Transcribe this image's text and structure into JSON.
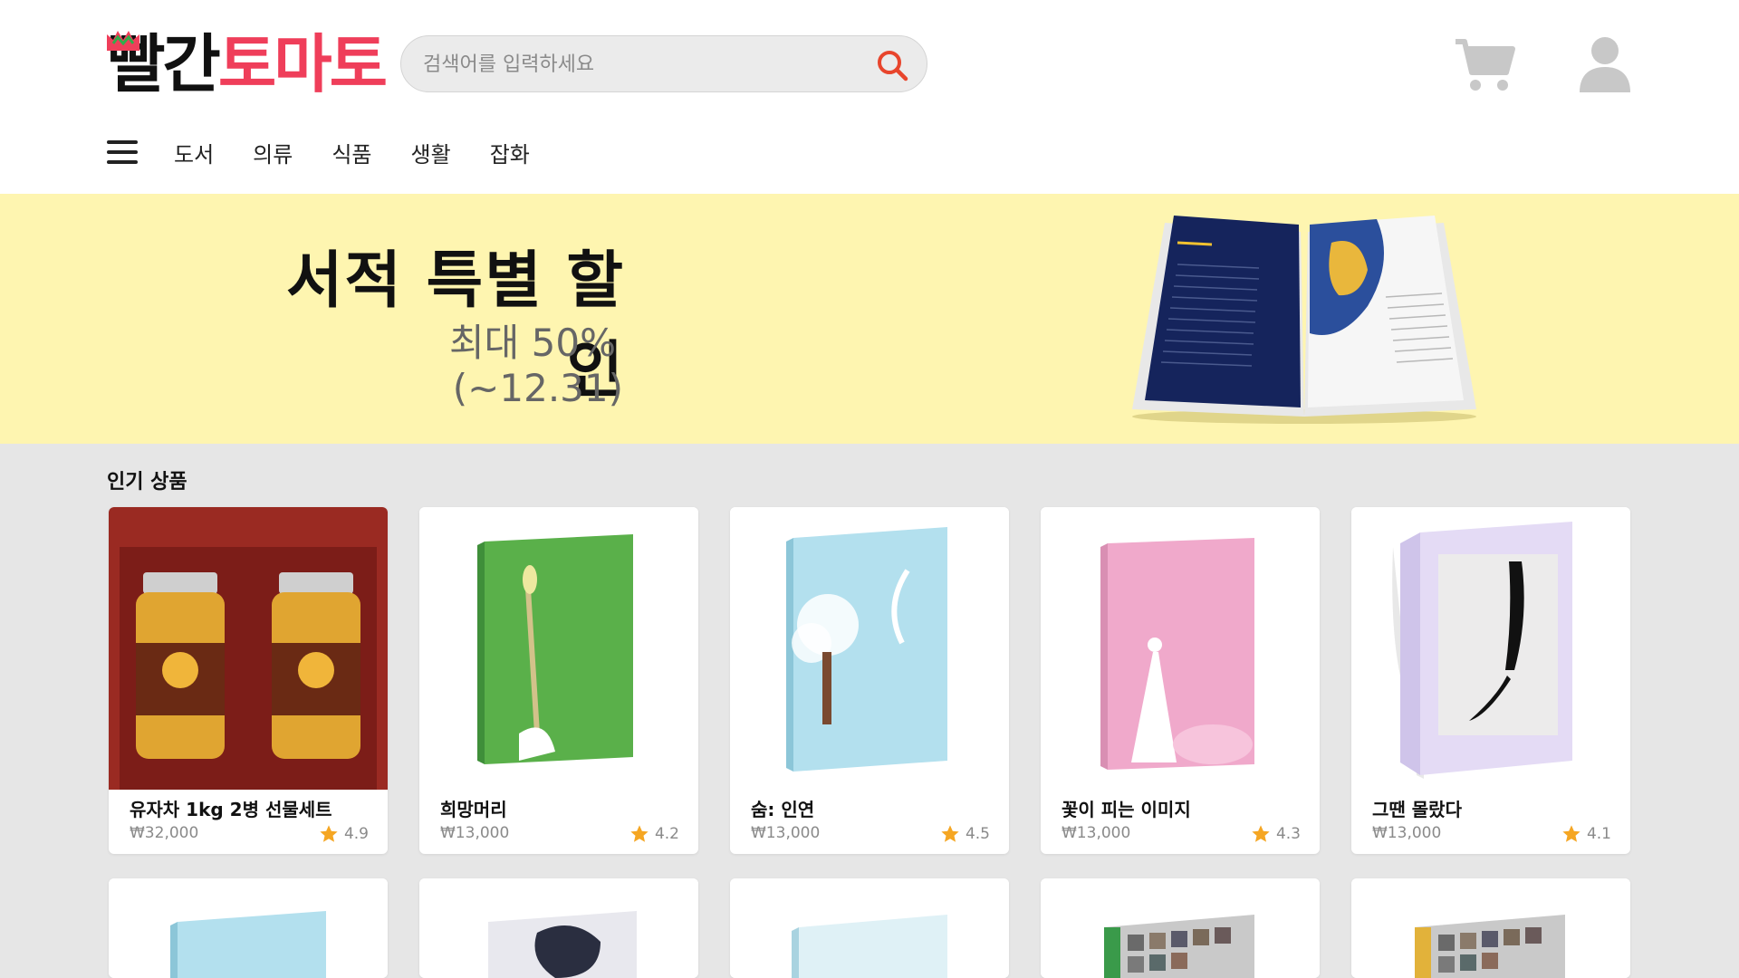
{
  "header": {
    "logo": {
      "part1": "빨간",
      "part2": "토마토"
    },
    "search": {
      "placeholder": "검색어를 입력하세요"
    },
    "nav": [
      "도서",
      "의류",
      "식품",
      "생활",
      "잡화"
    ]
  },
  "banner": {
    "title": "서적 특별 할인",
    "discount": "최대 50%",
    "period": "(~12.31)"
  },
  "section": {
    "title": "인기 상품"
  },
  "products": [
    {
      "name": "유자차 1kg 2병 선물세트",
      "price": "₩32,000",
      "rating": "4.9"
    },
    {
      "name": "희망머리",
      "price": "₩13,000",
      "rating": "4.2"
    },
    {
      "name": "숨: 인연",
      "price": "₩13,000",
      "rating": "4.5"
    },
    {
      "name": "꽃이 피는 이미지",
      "price": "₩13,000",
      "rating": "4.3"
    },
    {
      "name": "그땐 몰랐다",
      "price": "₩13,000",
      "rating": "4.1"
    }
  ],
  "icons": {
    "search": "search-icon",
    "cart": "cart-icon",
    "user": "user-icon",
    "menu": "hamburger-menu-icon",
    "rating": "star-icon"
  },
  "colors": {
    "brand_red": "#ef3e5a",
    "banner_bg": "#fef5b0",
    "section_bg": "#e6e6e6",
    "star": "#f5a623",
    "search_icon": "#e8452c"
  }
}
